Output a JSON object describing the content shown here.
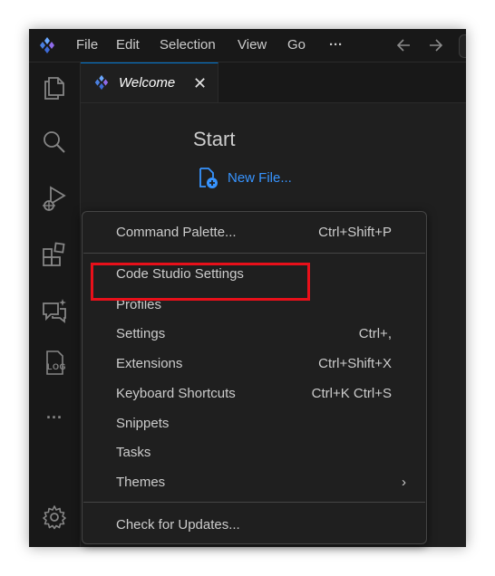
{
  "titlebar": {
    "menus": [
      "File",
      "Edit",
      "Selection",
      "View",
      "Go"
    ],
    "overflow": "···",
    "back_icon": "arrow-left-icon",
    "forward_icon": "arrow-right-icon",
    "logo_icon": "app-logo-icon"
  },
  "activity_bar": {
    "items": [
      "explorer-icon",
      "search-icon",
      "run-debug-icon",
      "extensions-icon",
      "chat-icon",
      "log-icon",
      "more-icon",
      "settings-gear-icon"
    ],
    "log_text": "LOG",
    "more_text": "···"
  },
  "tab": {
    "label": "Welcome",
    "close": "✕"
  },
  "welcome": {
    "start_title": "Start",
    "new_file": "New File..."
  },
  "menu": {
    "items": [
      {
        "label": "Command Palette...",
        "shortcut": "Ctrl+Shift+P"
      },
      {
        "label": "Code Studio Settings",
        "shortcut": ""
      },
      {
        "label": "Profiles",
        "shortcut": ""
      },
      {
        "label": "Settings",
        "shortcut": "Ctrl+,"
      },
      {
        "label": "Extensions",
        "shortcut": "Ctrl+Shift+X"
      },
      {
        "label": "Keyboard Shortcuts",
        "shortcut": "Ctrl+K Ctrl+S"
      },
      {
        "label": "Snippets",
        "shortcut": ""
      },
      {
        "label": "Tasks",
        "shortcut": ""
      },
      {
        "label": "Themes",
        "shortcut": ""
      },
      {
        "label": "Check for Updates...",
        "shortcut": ""
      }
    ],
    "themes_chevron": "›"
  },
  "colors": {
    "accent": "#3794ff",
    "highlight_box": "#e8101a",
    "background": "#1f1f1f"
  }
}
